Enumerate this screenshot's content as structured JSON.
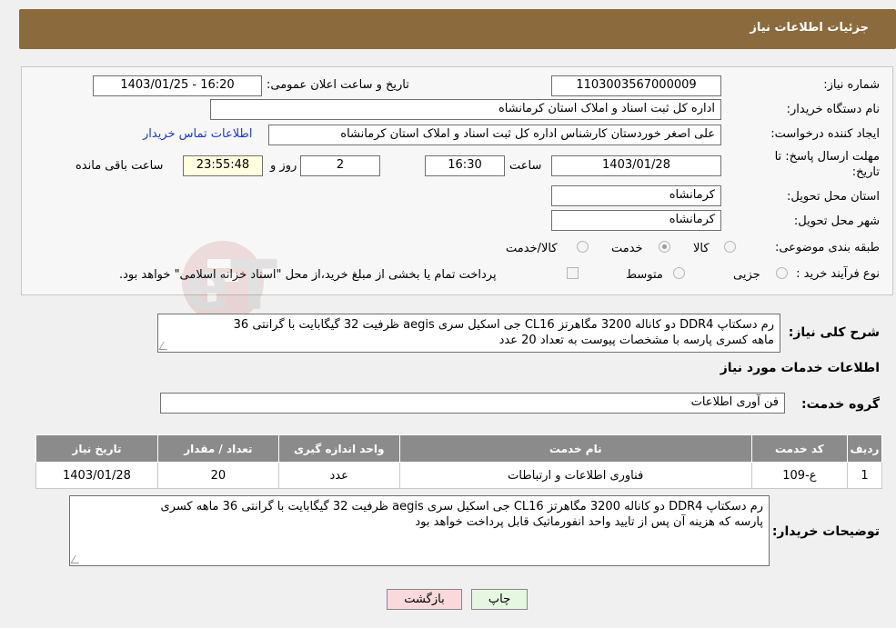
{
  "header": {
    "title": "جزئیات اطلاعات نیاز"
  },
  "form": {
    "need_number_label": "شماره نیاز:",
    "need_number": "1103003567000009",
    "announce_label": "تاریخ و ساعت اعلان عمومی:",
    "announce_value": "1403/01/25 - 16:20",
    "buyer_org_label": "نام دستگاه خریدار:",
    "buyer_org": "اداره کل ثبت اسناد و املاک استان کرمانشاه",
    "creator_label": "ایجاد کننده درخواست:",
    "creator": "علی اصغر خوردستان کارشناس اداره کل ثبت اسناد و املاک استان کرمانشاه",
    "contact_link": "اطلاعات تماس خریدار",
    "deadline_label_line1": "مهلت ارسال پاسخ: تا",
    "deadline_label_line2": "تاریخ:",
    "deadline_date": "1403/01/28",
    "time_label": "ساعت",
    "deadline_time": "16:30",
    "days_value": "2",
    "days_label": "روز و",
    "remaining_time": "23:55:48",
    "remaining_label": "ساعت باقی مانده",
    "province_label": "استان محل تحویل:",
    "province": "کرمانشاه",
    "city_label": "شهر محل تحویل:",
    "city": "کرمانشاه",
    "category_label": "طبقه بندی موضوعی:",
    "category_options": [
      "کالا",
      "خدمت",
      "کالا/خدمت"
    ],
    "category_selected": "خدمت",
    "process_label": "نوع فرآیند خرید :",
    "process_options": [
      "جزیی",
      "متوسط"
    ],
    "payment_note": "پرداخت تمام یا بخشی از مبلغ خرید،از محل \"اسناد خزانه اسلامی\" خواهد بود."
  },
  "summary": {
    "label": "شرح کلی نیاز:",
    "line1": "رم دسکتاپ DDR4 دو کاناله 3200 مگاهرتز CL16 جی اسکیل سری aegis ظرفیت 32 گیگابایت با گرانتی 36",
    "line2": "ماهه کسری پارسه  با مشخصات پیوست به تعداد 20 عدد"
  },
  "services": {
    "section_title": "اطلاعات خدمات مورد نیاز",
    "group_label": "گروه خدمت:",
    "group_value": "فن آوری اطلاعات",
    "columns": [
      "ردیف",
      "کد خدمت",
      "نام خدمت",
      "واحد اندازه گیری",
      "تعداد / مقدار",
      "تاریخ نیاز"
    ],
    "rows": [
      {
        "row": "1",
        "code": "ع-109",
        "name": "فناوری اطلاعات و ارتباطات",
        "unit": "عدد",
        "qty": "20",
        "date": "1403/01/28"
      }
    ]
  },
  "buyer_notes": {
    "label": "توضیحات خریدار:",
    "line1": "رم دسکتاپ DDR4 دو کاناله 3200 مگاهرتز CL16 جی اسکیل سری aegis ظرفیت 32 گیگابایت با گرانتی 36 ماهه کسری",
    "line2": "پارسه که هزینه آن پس از تایید واحد انفورماتیک قابل پرداخت خواهد بود"
  },
  "buttons": {
    "print": "چاپ",
    "back": "بازگشت"
  },
  "colors": {
    "header_bg": "#8b6b3d",
    "table_header_bg": "#8b8b8b",
    "print_btn": "#e6f7e1",
    "back_btn": "#f9d9d9",
    "link": "#1a3ad6"
  },
  "watermark": {
    "text": "AriaTender.neT"
  }
}
